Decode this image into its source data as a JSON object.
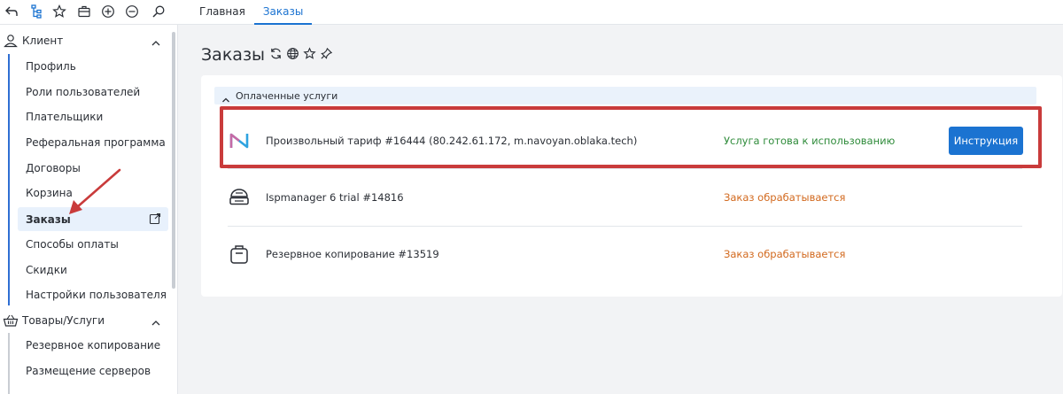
{
  "topbar": {
    "icons": [
      "back-arrow-icon",
      "tree-icon",
      "star-icon",
      "briefcase-icon",
      "plus-circle-icon",
      "minus-circle-icon",
      "search-icon"
    ],
    "tabs": [
      {
        "label": "Главная",
        "active": false
      },
      {
        "label": "Заказы",
        "active": true
      }
    ]
  },
  "sidebar": {
    "client": {
      "label": "Клиент",
      "items": [
        "Профиль",
        "Роли пользователей",
        "Плательщики",
        "Реферальная программа",
        "Договоры",
        "Корзина",
        "Заказы",
        "Способы оплаты",
        "Скидки",
        "Настройки пользователя"
      ],
      "active_item": "Заказы"
    },
    "goods": {
      "label": "Товары/Услуги",
      "items": [
        "Резервное копирование",
        "Размещение серверов"
      ]
    }
  },
  "main": {
    "title": "Заказы",
    "group": {
      "label": "Оплаченные услуги",
      "rows": [
        {
          "name": "Произвольный тариф #16444 (80.242.61.172, m.navoyan.oblaka.tech)",
          "status": "Услуга готова к использованию",
          "status_color": "#2e8b3a",
          "button": "Инструкция",
          "icon": "brand-logo-icon"
        },
        {
          "name": "Ispmanager 6 trial #14816",
          "status": "Заказ обрабатывается",
          "status_color": "#d2691e",
          "icon": "server-dome-icon"
        },
        {
          "name": "Резервное копирование #13519",
          "status": "Заказ обрабатывается",
          "status_color": "#d2691e",
          "icon": "backup-bag-icon"
        }
      ]
    }
  },
  "colors": {
    "accent": "#1b73d1",
    "highlight": "#c93b3b",
    "sidebar_line": "#2f6ed3"
  }
}
